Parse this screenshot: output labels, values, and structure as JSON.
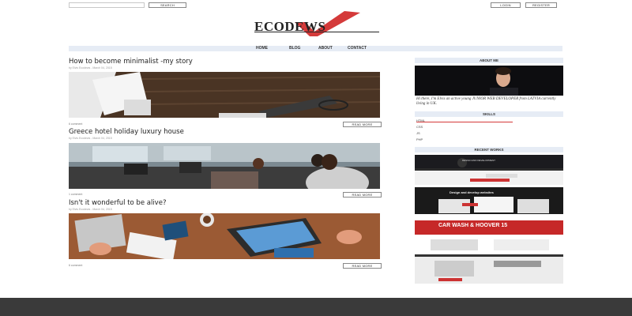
{
  "topbar": {
    "search_button": "SEARCH",
    "login_button": "LOGIN",
    "register_button": "REGISTER"
  },
  "logo": {
    "text": "ECODEWS"
  },
  "nav": {
    "items": [
      "HOME",
      "BLOG",
      "ABOUT",
      "CONTACT"
    ]
  },
  "posts": [
    {
      "title": "How to become minimalist -my story",
      "meta": "by Elvis Ecodews - March 04, 2015",
      "comments": "6 comment",
      "read_more": "READ MORE"
    },
    {
      "title": "Greece hotel holiday luxury house",
      "meta": "by Elvis Ecodews - March 04, 2015",
      "comments": "1 comment",
      "read_more": "READ MORE"
    },
    {
      "title": "Isn't it wonderful to be alive?",
      "meta": "by Elvis Ecodews - March 04, 2015",
      "comments": "6 comment",
      "read_more": "READ MORE"
    }
  ],
  "sidebar": {
    "about_title": "ABOUT ME",
    "about_text": "Hi there, I'm Elvis an active young JUNIOR WEB DEVELOPER from LATVIA currently living in UK.",
    "skills_title": "SKILLS",
    "skills": [
      {
        "name": "HTML",
        "level": 0.65
      },
      {
        "name": "CSS",
        "level": 0
      },
      {
        "name": "JS",
        "level": 0
      },
      {
        "name": "PHP",
        "level": 0
      }
    ],
    "works_title": "RECENT WORKS",
    "works": [
      {
        "caption": "DESIGN AND DEVELOPMENT"
      },
      {
        "caption": "Design and develop websites"
      },
      {
        "caption": "CAR WASH & HOOVER 15"
      },
      {
        "caption": ""
      }
    ]
  },
  "colors": {
    "accent": "#d43a3a",
    "nav_bg": "#e6ecf5",
    "footer_bg": "#3a3a3a"
  }
}
